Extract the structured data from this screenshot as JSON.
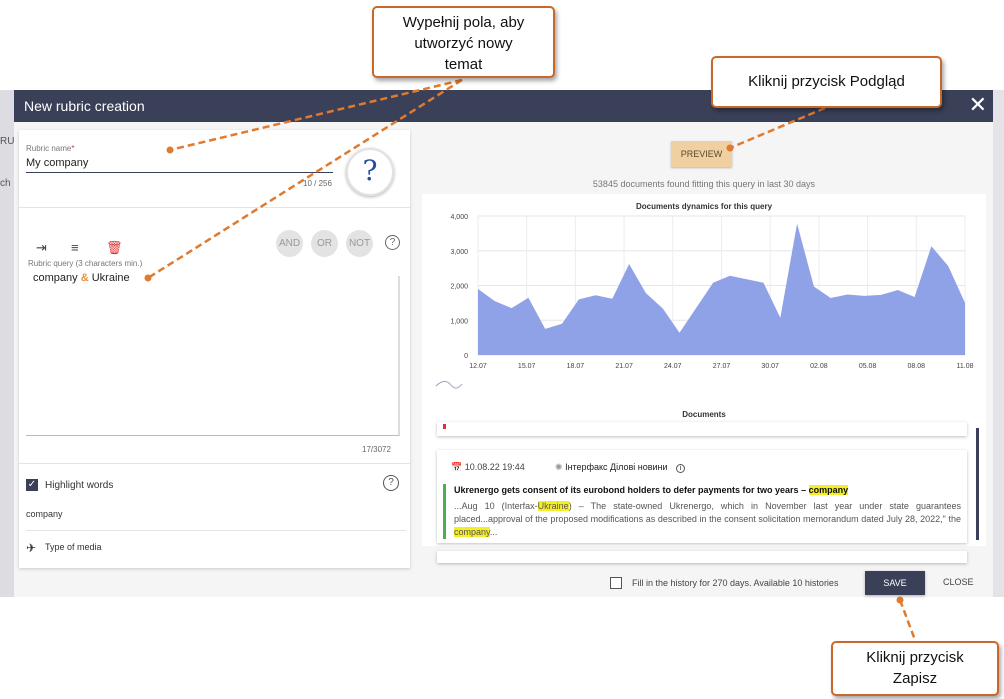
{
  "callouts": {
    "fill_fields": [
      "Wypełnij pola, aby",
      "utworzyć nowy",
      "temat"
    ],
    "preview_hint": "Kliknij przycisk Podgląd",
    "save_hint": [
      "Kliknij przycisk",
      "Zapisz"
    ]
  },
  "background_fragments": {
    "left_top": "RU",
    "left_mid": "ch"
  },
  "dialog": {
    "title": "New rubric creation",
    "close_icon": "close-icon"
  },
  "rubric_name": {
    "label": "Rubric name",
    "required_mark": "*",
    "value": "My company",
    "counter": "10 / 256"
  },
  "query": {
    "label": "Rubric query (3 characters min.)",
    "term1": "company",
    "operator": "&",
    "term2": "Ukraine",
    "counter": "17/3072",
    "tools": [
      "indent-icon",
      "format-icon",
      "delete-icon"
    ],
    "operators": [
      "AND",
      "OR",
      "NOT"
    ],
    "help": "?"
  },
  "highlight": {
    "label": "Highlight words",
    "checked": true,
    "value": "company",
    "help": "?"
  },
  "media": {
    "label": "Type of media"
  },
  "preview": {
    "button": "PREVIEW",
    "found_text": "53845 documents found fitting this query in last 30 days"
  },
  "chart_data": {
    "type": "area",
    "title": "Documents dynamics for this query",
    "xlabel": "",
    "ylabel": "",
    "ylim": [
      0,
      4000
    ],
    "y_ticks": [
      "0",
      "1,000",
      "2,000",
      "3,000",
      "4,000"
    ],
    "x_ticks": [
      "12.07",
      "15.07",
      "18.07",
      "21.07",
      "24.07",
      "27.07",
      "30.07",
      "02.08",
      "05.08",
      "08.08",
      "11.08"
    ],
    "x_range": [
      "12.07",
      "11.08"
    ],
    "color": "#8a9de6",
    "grid": true,
    "values": [
      1900,
      1550,
      1350,
      1650,
      750,
      900,
      1600,
      1720,
      1620,
      2620,
      1780,
      1340,
      640,
      1360,
      2080,
      2280,
      2180,
      2080,
      1070,
      3780,
      1970,
      1640,
      1740,
      1700,
      1730,
      1870,
      1670,
      3130,
      2560,
      1500
    ]
  },
  "documents": {
    "title": "Documents",
    "items": [
      {
        "date": "10.08.22 19:44",
        "source": "Інтерфакс Ділові новини",
        "headline_pre": "Ukrenergo gets consent of its eurobond holders to defer payments for two years – ",
        "headline_hl": "company",
        "line1_pre": "...Aug 10 (Interfax-",
        "line1_hl": "Ukraine",
        "line1_post": ") – The state-owned Ukrenergo, which in November last year under state guarantees",
        "line2": "placed...approval of the proposed modifications as described in the consent solicitation memorandum dated July 28,",
        "line3_pre": "2022,\" the ",
        "line3_hl": "company",
        "line3_post": "..."
      }
    ]
  },
  "footer": {
    "history_text": "Fill in the history for 270 days. Available 10 histories",
    "history_checked": false,
    "save": "SAVE",
    "close": "CLOSE"
  },
  "colors": {
    "header": "#3a4057",
    "accent": "#e8913a",
    "preview_button": "#f0cfa0",
    "callout_border": "#c8692a",
    "chart_fill": "#8a9de6"
  }
}
